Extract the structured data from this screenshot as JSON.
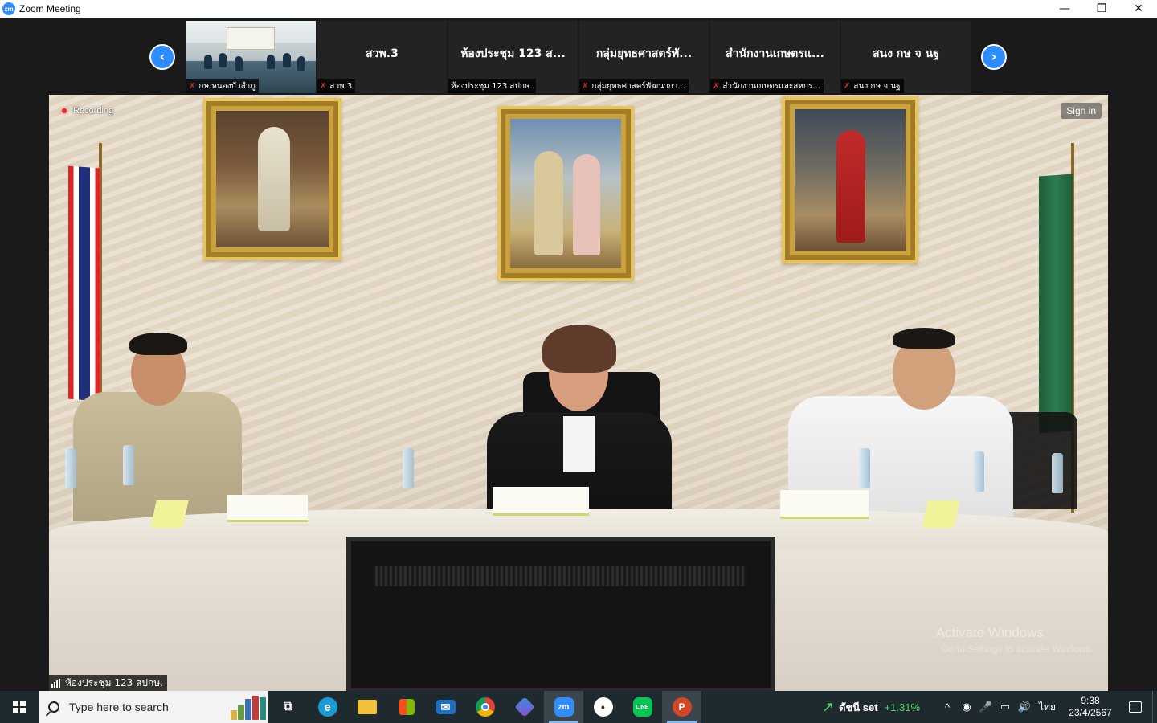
{
  "window": {
    "logo_text": "zm",
    "title": "Zoom Meeting",
    "controls": {
      "minimize": "—",
      "restore": "❐",
      "close": "✕"
    }
  },
  "thumbnail_strip": {
    "prev_glyph": "‹",
    "next_glyph": "›",
    "tiles": [
      {
        "type": "video",
        "label": "กษ.หนองบัวลำภู",
        "muted": true
      },
      {
        "type": "name",
        "name": "สวพ.3",
        "label": "สวพ.3",
        "muted": true
      },
      {
        "type": "name",
        "name": "ห้องประชุม 123 ส...",
        "label": "ห้องประชุม 123 สปกษ.",
        "muted": false
      },
      {
        "type": "name",
        "name": "กลุ่มยุทธศาสตร์พั...",
        "label": "กลุ่มยุทธศาสตร์พัฒนากา...",
        "muted": true
      },
      {
        "type": "name",
        "name": "สำนักงานเกษตรแ...",
        "label": "สำนักงานเกษตรและสหกร...",
        "muted": true
      },
      {
        "type": "name",
        "name": "สนง กษ จ นฐ",
        "label": "สนง กษ จ นฐ",
        "muted": true
      }
    ]
  },
  "main_video": {
    "recording_label": "Recording",
    "signin_label": "Sign in",
    "speaker_label": "ห้องประชุม 123 สปกษ.",
    "watermark_title": "Activate Windows",
    "watermark_sub": "Go to Settings to activate Windows."
  },
  "taskbar": {
    "search_placeholder": "Type here to search",
    "apps": [
      {
        "name": "task-view",
        "label": "⧉",
        "color": "#1f2a2f",
        "active": false
      },
      {
        "name": "edge",
        "label": "e",
        "color": "#1b9ad6",
        "active": false
      },
      {
        "name": "file-explorer",
        "label": "",
        "color": "#f2c038",
        "active": false
      },
      {
        "name": "microsoft-store",
        "label": "",
        "color": "#2a7fd4",
        "active": false
      },
      {
        "name": "mail",
        "label": "✉",
        "color": "#1f6fc4",
        "active": false
      },
      {
        "name": "chrome",
        "label": "",
        "color": "#db4437",
        "active": false
      },
      {
        "name": "copilot",
        "label": "",
        "color": "#5b58d6",
        "active": false
      },
      {
        "name": "zoom",
        "label": "zm",
        "color": "#2D8CFF",
        "active": true
      },
      {
        "name": "app-circle",
        "label": "●",
        "color": "#ffffff",
        "active": false
      },
      {
        "name": "line",
        "label": "LINE",
        "color": "#06c755",
        "active": false
      },
      {
        "name": "powerpoint",
        "label": "P",
        "color": "#d24726",
        "active": true
      }
    ],
    "stock": {
      "name": "ดัชนี set",
      "change": "+1.31%"
    },
    "tray_icons": [
      "^",
      "◉",
      "🎤",
      "▭",
      "🔊"
    ],
    "language": "ไทย",
    "time": "9:38",
    "date": "23/4/2567"
  }
}
